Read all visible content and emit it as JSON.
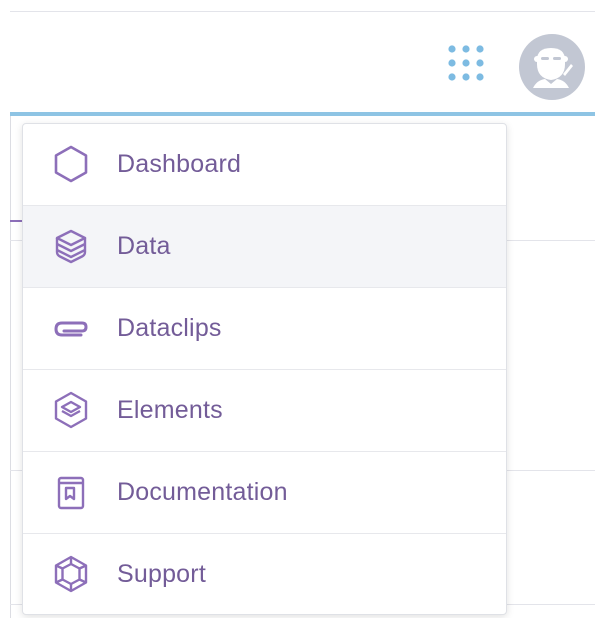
{
  "header": {
    "apps_icon": "grid-dots-icon",
    "avatar_icon": "user-avatar-icon",
    "colors": {
      "accent": "#8ec4e4",
      "apps_dots": "#7dbbe2",
      "avatar_bg": "#c2c7d3"
    }
  },
  "menu": {
    "items": [
      {
        "label": "Dashboard",
        "icon": "hexagon-icon"
      },
      {
        "label": "Data",
        "icon": "layers-icon"
      },
      {
        "label": "Dataclips",
        "icon": "paperclip-icon"
      },
      {
        "label": "Elements",
        "icon": "elements-cube-icon"
      },
      {
        "label": "Documentation",
        "icon": "book-icon"
      },
      {
        "label": "Support",
        "icon": "support-hexagon-icon"
      }
    ],
    "active_index": 1,
    "colors": {
      "text": "#735c98",
      "icon": "#8d6fb9",
      "active_bg": "#f4f5f8"
    }
  }
}
